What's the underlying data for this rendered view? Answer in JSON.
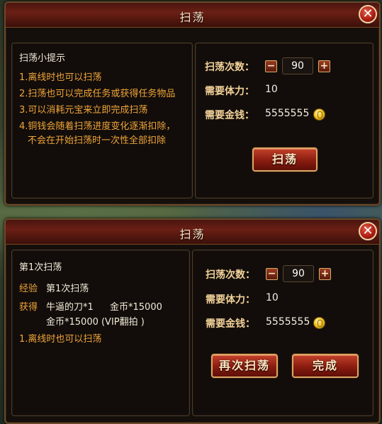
{
  "dialog1": {
    "title": "扫荡",
    "close": "✕",
    "tips_title": "扫荡小提示",
    "tips": [
      "1.离线时也可以扫荡",
      "2.扫荡也可以完成任务或获得任务物品",
      "3.可以消耗元宝来立即完成扫荡",
      "4.铜钱会随着扫荡进度变化逐渐扣除，",
      "不会在开始扫荡时一次性全部扣除"
    ],
    "count_label": "扫荡次数：",
    "count_minus": "−",
    "count_value": "90",
    "count_plus": "+",
    "stamina_label": "需要体力：",
    "stamina_value": "10",
    "money_label": "需要金钱：",
    "money_value": "5555555",
    "coin_icon": "gold-coin-icon",
    "sweep_button": "扫荡"
  },
  "dialog2": {
    "title": "扫荡",
    "close": "✕",
    "round_title": "第1次扫荡",
    "exp_label": "经验",
    "exp_value": "第1次扫荡",
    "reward_label": "获得",
    "reward_line1_item": "牛逼的刀*1",
    "reward_line1_gold": "金币*15000",
    "reward_line2": "金币*15000 (VIP翻拍 )",
    "tip": "1.离线时也可以扫荡",
    "count_label": "扫荡次数：",
    "count_minus": "−",
    "count_value": "90",
    "count_plus": "+",
    "stamina_label": "需要体力：",
    "stamina_value": "10",
    "money_label": "需要金钱：",
    "money_value": "5555555",
    "coin_icon": "gold-coin-icon",
    "again_button": "再次扫荡",
    "done_button": "完成"
  }
}
